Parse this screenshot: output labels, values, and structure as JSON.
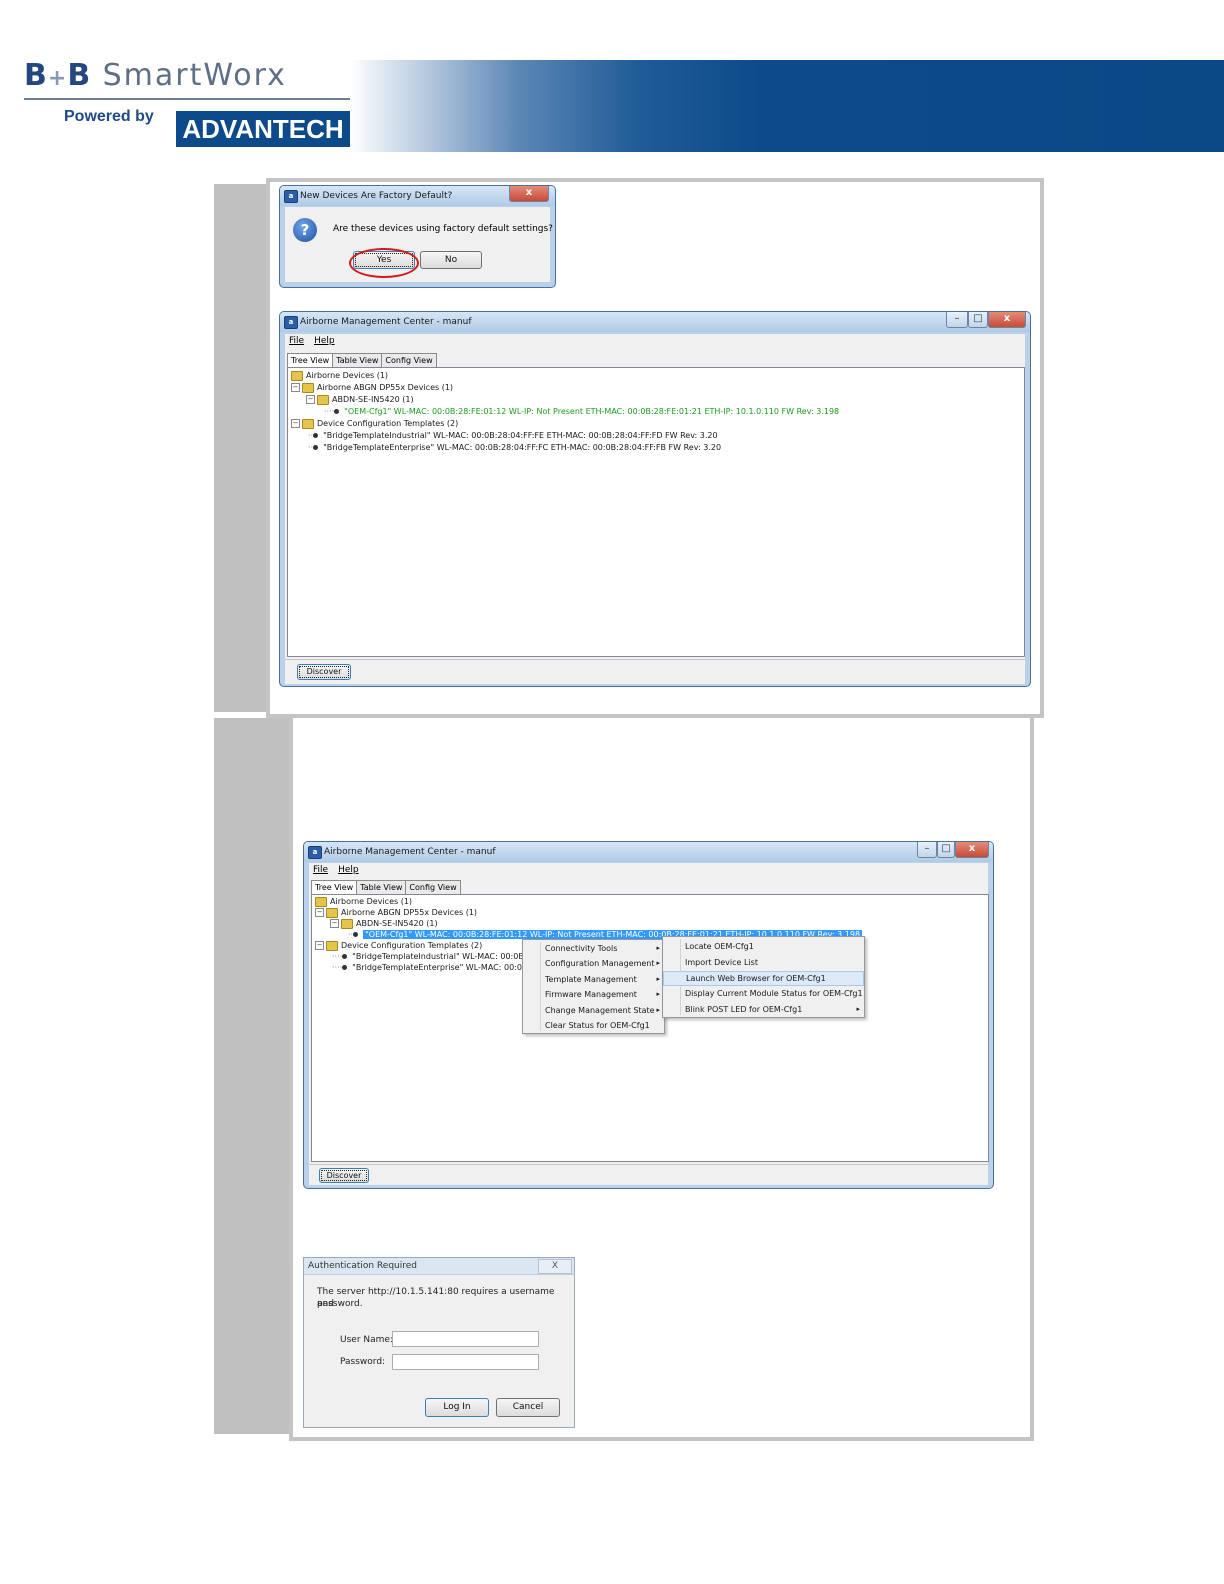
{
  "header": {
    "logo_bb": "B+B",
    "logo_plus": "+",
    "logo_b1": "B",
    "logo_b2": "B",
    "logo_smartworx": "SmartWorx",
    "powered_by": "Powered by",
    "advantech": "ADVANTECH"
  },
  "dialog_factory_default": {
    "title": "New Devices Are Factory Default?",
    "icon": "question-icon",
    "message": "Are these devices using factory default settings?",
    "yes_label": "Yes",
    "no_label": "No",
    "close_label": "x"
  },
  "amc_window_1": {
    "title": "Airborne Management Center - manuf",
    "menu": {
      "file": "File",
      "help": "Help"
    },
    "tabs": [
      "Tree View",
      "Table View",
      "Config View"
    ],
    "tree": {
      "root": "Airborne Devices (1)",
      "group1": "Airborne ABGN DP55x Devices (1)",
      "subgroup1": "ABDN-SE-IN5420 (1)",
      "device1": "\"OEM-Cfg1\"    WL-MAC: 00:0B:28:FE:01:12    WL-IP: Not Present    ETH-MAC: 00:0B:28:FE:01:21    ETH-IP: 10.1.0.110    FW Rev: 3.198",
      "group2": "Device Configuration Templates (2)",
      "template1": "\"BridgeTemplateIndustrial\"    WL-MAC: 00:0B:28:04:FF:FE    ETH-MAC: 00:0B:28:04:FF:FD    FW Rev: 3.20",
      "template2": "\"BridgeTemplateEnterprise\"    WL-MAC: 00:0B:28:04:FF:FC    ETH-MAC: 00:0B:28:04:FF:FB    FW Rev: 3.20"
    },
    "discover_label": "Discover"
  },
  "amc_window_2": {
    "title": "Airborne Management Center - manuf",
    "menu": {
      "file": "File",
      "help": "Help"
    },
    "tabs": [
      "Tree View",
      "Table View",
      "Config View"
    ],
    "tree": {
      "root": "Airborne Devices (1)",
      "group1": "Airborne ABGN DP55x Devices (1)",
      "subgroup1": "ABDN-SE-IN5420 (1)",
      "device1": "\"OEM-Cfg1\"    WL-MAC: 00:0B:28:FE:01:12    WL-IP: Not Present    ETH-MAC: 00:0B:28:FE:01:21    ETH-IP: 10.1.0.110    FW Rev: 3.198",
      "group2": "Device Configuration Templates (2)",
      "template1": "\"BridgeTemplateIndustrial\"    WL-MAC: 00:0B:28:0",
      "template2": "\"BridgeTemplateEnterprise\"    WL-MAC: 00:0B:28:0"
    },
    "context_menu": [
      "Connectivity Tools",
      "Configuration Management",
      "Template Management",
      "Firmware Management",
      "Change Management State",
      "Clear Status for OEM-Cfg1"
    ],
    "submenu": [
      "Locate OEM-Cfg1",
      "Import Device List",
      "Launch Web Browser for OEM-Cfg1",
      "Display Current Module Status for OEM-Cfg1",
      "Blink POST LED for OEM-Cfg1"
    ],
    "discover_label": "Discover"
  },
  "auth_dialog": {
    "title": "Authentication Required",
    "close_label": "X",
    "message_line1": "The server http://10.1.5.141:80 requires a username and",
    "message_line2": "password.",
    "username_label": "User Name:",
    "password_label": "Password:",
    "username_value": "",
    "password_value": "",
    "login_label": "Log In",
    "cancel_label": "Cancel"
  },
  "colors": {
    "banner_blue": "#0c4a8a",
    "logo_blue": "#25477f",
    "green_text": "#1d9c1d",
    "highlight_red": "#d11a1a",
    "selection_blue": "#3399ff"
  }
}
